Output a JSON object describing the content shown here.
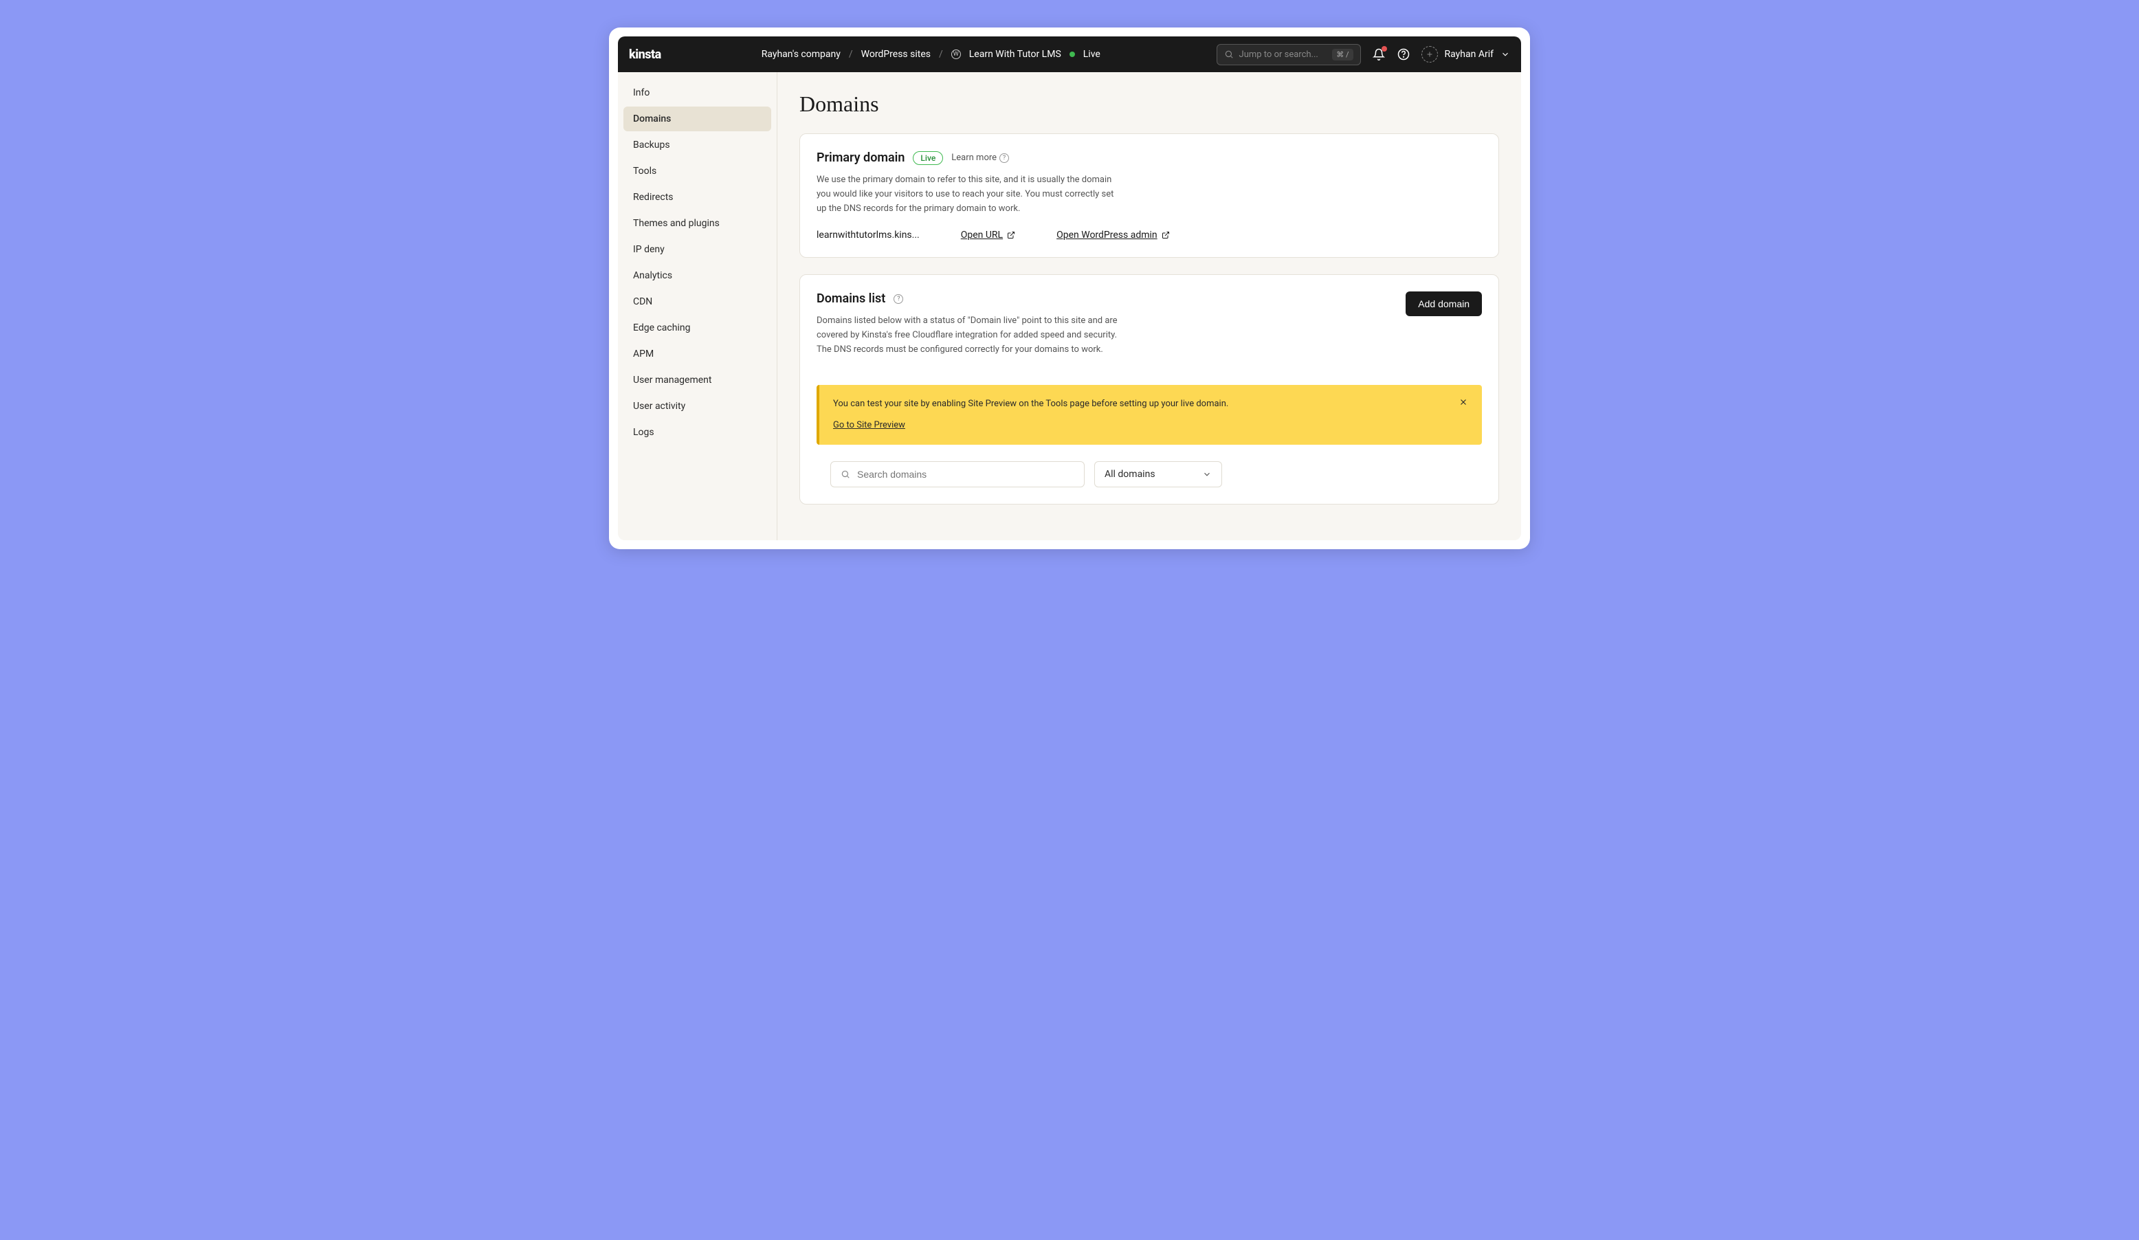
{
  "topbar": {
    "logo": "kinsta",
    "breadcrumb": {
      "company": "Rayhan's company",
      "section": "WordPress sites",
      "site": "Learn With Tutor LMS",
      "env": "Live"
    },
    "search_placeholder": "Jump to or search...",
    "search_kbd": "⌘ /",
    "user_name": "Rayhan Arif"
  },
  "sidebar": {
    "items": [
      "Info",
      "Domains",
      "Backups",
      "Tools",
      "Redirects",
      "Themes and plugins",
      "IP deny",
      "Analytics",
      "CDN",
      "Edge caching",
      "APM",
      "User management",
      "User activity",
      "Logs"
    ],
    "active_index": 1
  },
  "page": {
    "title": "Domains"
  },
  "primary": {
    "title": "Primary domain",
    "badge": "Live",
    "learn_more": "Learn more",
    "desc": "We use the primary domain to refer to this site, and it is usually the domain you would like your visitors to use to reach your site. You must correctly set up the DNS records for the primary domain to work.",
    "domain": "learnwithtutorlms.kins...",
    "open_url": "Open URL",
    "open_wp": "Open WordPress admin"
  },
  "domains_list": {
    "title": "Domains list",
    "add_btn": "Add domain",
    "desc": "Domains listed below with a status of \"Domain live\" point to this site and are covered by Kinsta's free Cloudflare integration for added speed and security. The DNS records must be configured correctly for your domains to work.",
    "alert_text": "You can test your site by enabling Site Preview on the Tools page before setting up your live domain.",
    "alert_link": "Go to Site Preview",
    "search_placeholder": "Search domains",
    "filter_value": "All domains"
  }
}
